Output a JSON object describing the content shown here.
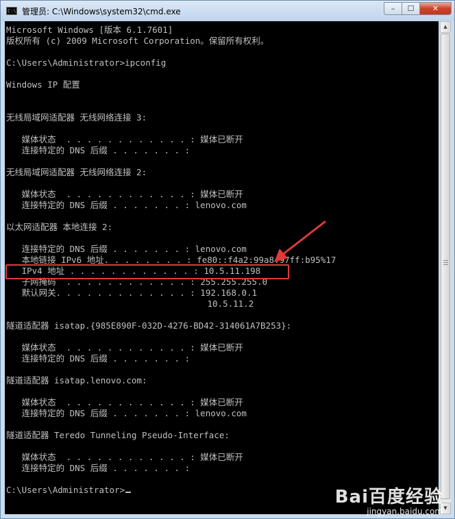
{
  "window": {
    "title": "管理员: C:\\Windows\\system32\\cmd.exe",
    "icon": "cmd-window-icon",
    "icon_text": "C:\\",
    "minimize_label": "–",
    "maximize_label": "☐",
    "close_label": "✕"
  },
  "console": {
    "lines": [
      "Microsoft Windows [版本 6.1.7601]",
      "版权所有 (c) 2009 Microsoft Corporation。保留所有权利。",
      "",
      "C:\\Users\\Administrator>ipconfig",
      "",
      "Windows IP 配置",
      "",
      "",
      "无线局域网适配器 无线网络连接 3:",
      "",
      "   媒体状态  . . . . . . . . . . . . : 媒体已断开",
      "   连接特定的 DNS 后缀 . . . . . . . :",
      "",
      "无线局域网适配器 无线网络连接 2:",
      "",
      "   媒体状态  . . . . . . . . . . . . : 媒体已断开",
      "   连接特定的 DNS 后缀 . . . . . . . : lenovo.com",
      "",
      "以太网适配器 本地连接 2:",
      "",
      "   连接特定的 DNS 后缀 . . . . . . . : lenovo.com",
      "   本地链接 IPv6 地址. . . . . . . . : fe80::f4a2:99a8:97ff:b95%17",
      "   IPv4 地址 . . . . . . . . . . . . : 10.5.11.198",
      "   子网掩码  . . . . . . . . . . . . : 255.255.255.0",
      "   默认网关. . . . . . . . . . . . . : 192.168.0.1",
      "                                       10.5.11.2",
      "",
      "隧道适配器 isatap.{985E890F-032D-4276-BD42-314061A7B253}:",
      "",
      "   媒体状态  . . . . . . . . . . . . : 媒体已断开",
      "   连接特定的 DNS 后缀 . . . . . . . :",
      "",
      "隧道适配器 isatap.lenovo.com:",
      "",
      "   媒体状态  . . . . . . . . . . . . : 媒体已断开",
      "   连接特定的 DNS 后缀 . . . . . . . : lenovo.com",
      "",
      "隧道适配器 Teredo Tunneling Pseudo-Interface:",
      "",
      "   媒体状态  . . . . . . . . . . . . : 媒体已断开",
      "   连接特定的 DNS 后缀 . . . . . . . :",
      "",
      "C:\\Users\\Administrator>"
    ],
    "highlighted_line": "   IPv4 地址 . . . . . . . . . . . . : 10.5.11.198"
  },
  "colors": {
    "console_bg": "#000000",
    "console_text": "#c0c0c0",
    "annotation": "#e23a3a"
  },
  "watermark": {
    "logo": "Bai百度经验",
    "url": "jingyan.baidu.com"
  }
}
